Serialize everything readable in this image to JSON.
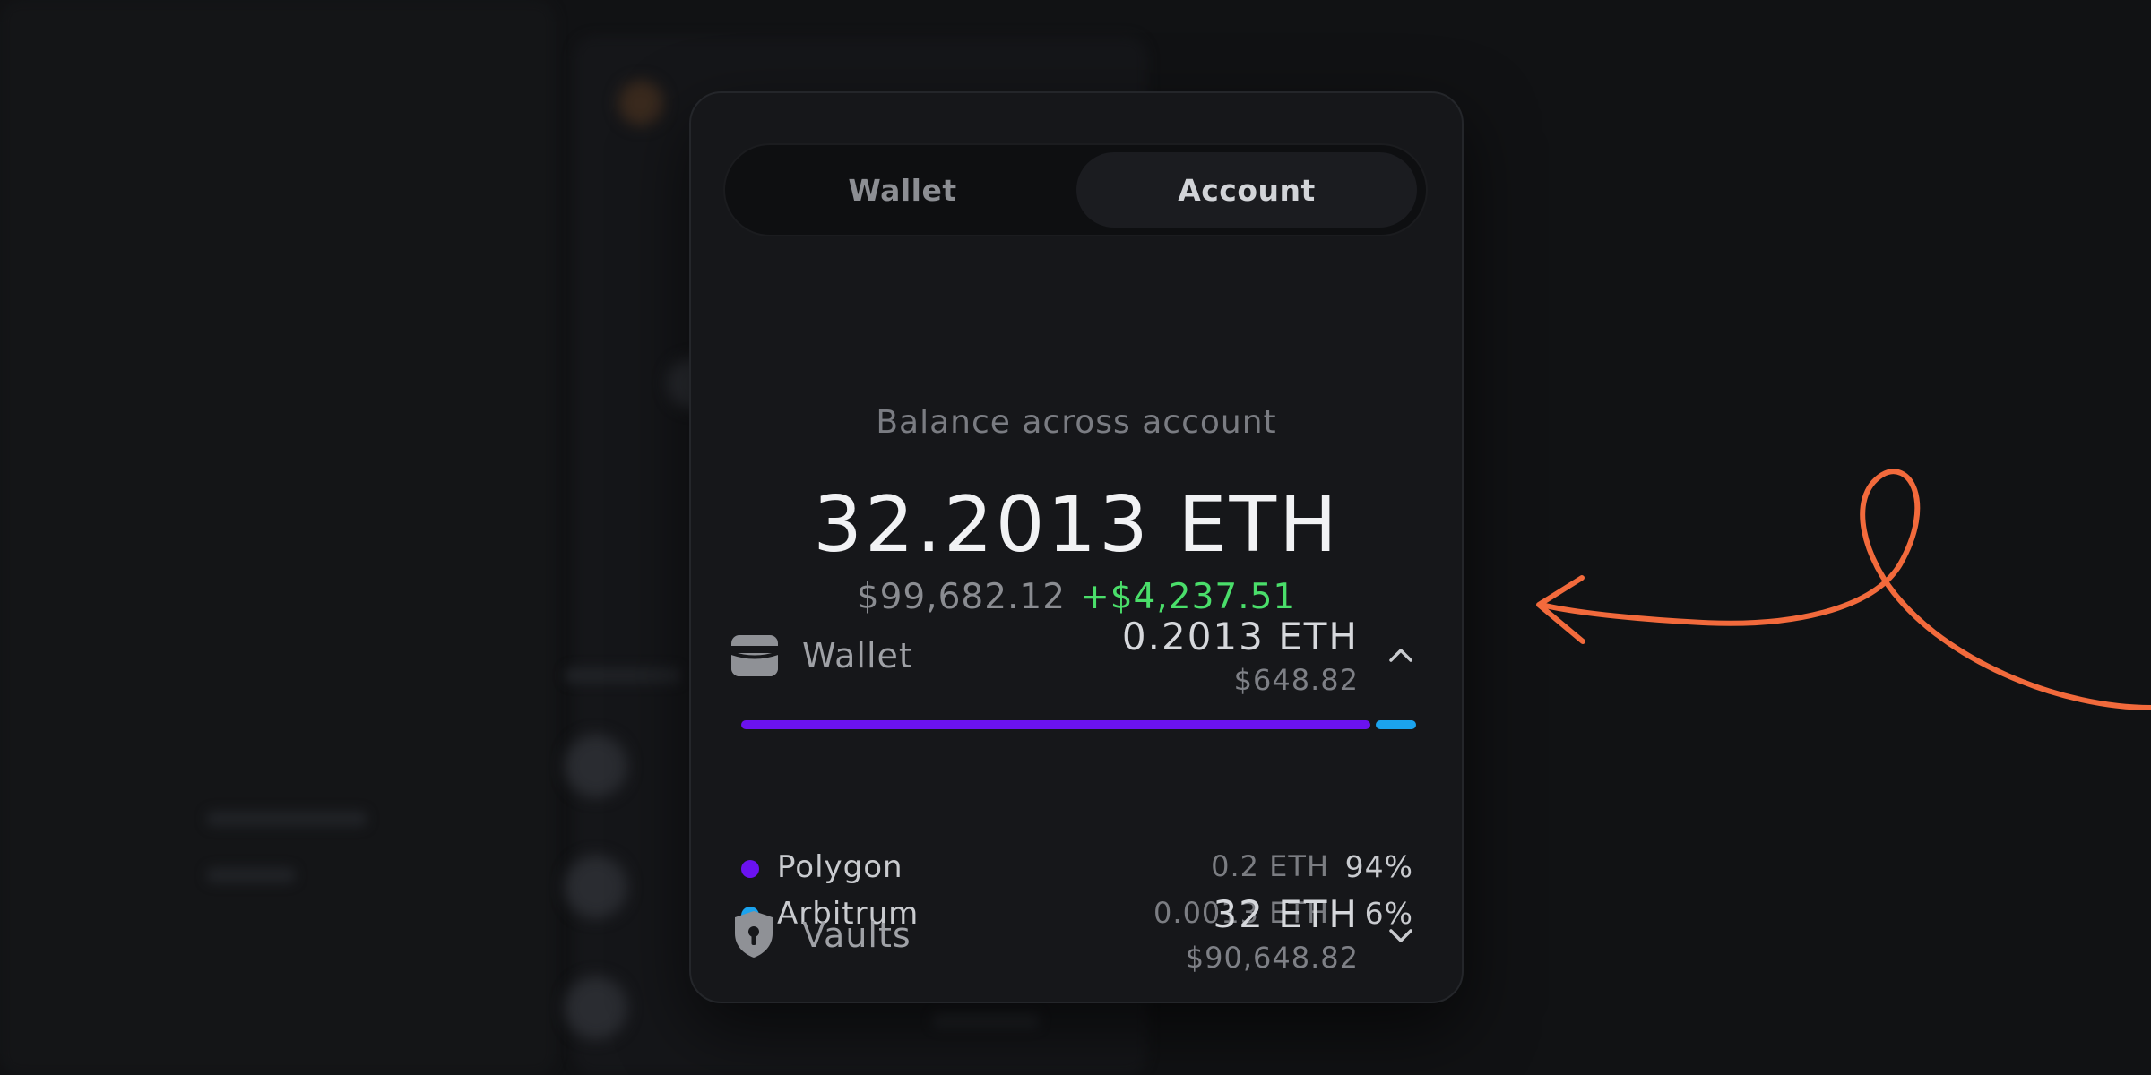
{
  "tabs": [
    {
      "label": "Wallet",
      "active": false
    },
    {
      "label": "Account",
      "active": true
    }
  ],
  "balance": {
    "subtitle": "Balance across account",
    "eth": "32.2013 ETH",
    "usd": "$99,682.12",
    "change": "+$4,237.51"
  },
  "wallet_section": {
    "label": "Wallet",
    "icon": "wallet-icon",
    "amount": "0.2013 ETH",
    "usd": "$648.82",
    "expanded": true,
    "chains": [
      {
        "name": "Polygon",
        "eth": "0.2 ETH",
        "pct": "94%",
        "share": 0.94,
        "color": "#6b12f0"
      },
      {
        "name": "Arbitrum",
        "eth": "0.0013 ETH",
        "pct": "6%",
        "share": 0.06,
        "color": "#1ba3ee"
      }
    ]
  },
  "vaults_section": {
    "label": "Vaults",
    "icon": "shield-lock-icon",
    "amount": "32 ETH",
    "usd": "$90,648.82",
    "expanded": false
  },
  "colors": {
    "accent_arrow": "#f26a3c",
    "positive": "#4ade6a"
  }
}
